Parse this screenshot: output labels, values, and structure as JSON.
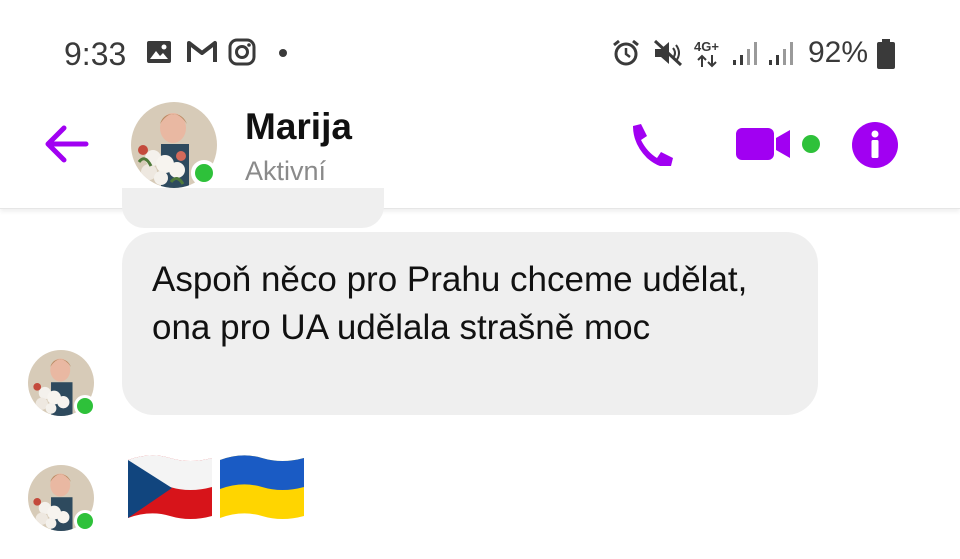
{
  "status_bar": {
    "time": "9:33",
    "battery": "92%",
    "network": "4G+",
    "icons": [
      "gallery-icon",
      "gmail-icon",
      "instagram-icon",
      "notification-dot-icon",
      "alarm-icon",
      "mute-icon",
      "signal-icon",
      "battery-icon"
    ]
  },
  "header": {
    "contact_name": "Marija",
    "contact_status": "Aktivní",
    "icons": [
      "back-arrow-icon",
      "phone-icon",
      "video-icon",
      "info-icon"
    ]
  },
  "messages": [
    {
      "text": "Aspoň něco pro Prahu chceme udělat, ona pro UA udělala strašně moc"
    },
    {
      "emoji": [
        "flag-czech-republic",
        "flag-ukraine"
      ]
    }
  ],
  "colors": {
    "accent": "#a100f2",
    "online": "#2ec13a",
    "bubble": "#efefef"
  }
}
